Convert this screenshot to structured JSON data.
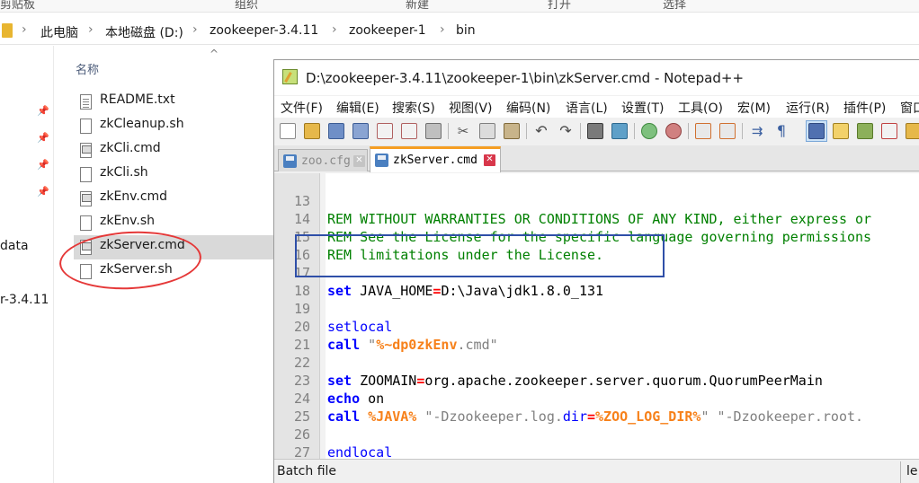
{
  "explorer": {
    "ribbon_groups": [
      "剪贴板",
      "组织",
      "新建",
      "打开",
      "选择"
    ],
    "breadcrumb": [
      "此电脑",
      "本地磁盘 (D:)",
      "zookeeper-3.4.11",
      "zookeeper-1",
      "bin"
    ],
    "nav_partial_labels": [
      "data",
      "r-3.4.11"
    ],
    "column_header": "名称",
    "files": [
      {
        "name": "README.txt",
        "icon": "text-file-icon"
      },
      {
        "name": "zkCleanup.sh",
        "icon": "blank-file-icon"
      },
      {
        "name": "zkCli.cmd",
        "icon": "cmd-file-icon"
      },
      {
        "name": "zkCli.sh",
        "icon": "blank-file-icon"
      },
      {
        "name": "zkEnv.cmd",
        "icon": "cmd-file-icon"
      },
      {
        "name": "zkEnv.sh",
        "icon": "blank-file-icon"
      },
      {
        "name": "zkServer.cmd",
        "icon": "cmd-file-icon",
        "selected": true
      },
      {
        "name": "zkServer.sh",
        "icon": "blank-file-icon"
      }
    ],
    "annotation_color": "#e53838"
  },
  "npp": {
    "title": "D:\\zookeeper-3.4.11\\zookeeper-1\\bin\\zkServer.cmd - Notepad++",
    "menu": [
      "文件(F)",
      "编辑(E)",
      "搜索(S)",
      "视图(V)",
      "编码(N)",
      "语言(L)",
      "设置(T)",
      "工具(O)",
      "宏(M)",
      "运行(R)",
      "插件(P)",
      "窗口"
    ],
    "tabs": [
      {
        "label": "zoo.cfg",
        "active": false
      },
      {
        "label": "zkServer.cmd",
        "active": true
      }
    ],
    "code_lines": [
      {
        "n": "13"
      },
      {
        "n": "14"
      },
      {
        "n": "15"
      },
      {
        "n": "16"
      },
      {
        "n": "17"
      },
      {
        "n": "18"
      },
      {
        "n": "19"
      },
      {
        "n": "20"
      },
      {
        "n": "21"
      },
      {
        "n": "22"
      },
      {
        "n": "23"
      },
      {
        "n": "24"
      },
      {
        "n": "25"
      },
      {
        "n": "26"
      },
      {
        "n": "27"
      }
    ],
    "code": {
      "l13": "REM WITHOUT WARRANTIES OR CONDITIONS OF ANY KIND, either express or",
      "l14": "REM See the License for the specific language governing permissions",
      "l15": "REM limitations under the License.",
      "l17_kw": "set",
      "l17_name": " JAVA_HOME",
      "l17_eq": "=",
      "l17_val": "D:\\Java\\jdk1.8.0_131",
      "l19": "setlocal",
      "l20_kw": "call",
      "l20_q1": " \"",
      "l20_var": "%~dp0zkEnv",
      "l20_rest": ".cmd\"",
      "l22_kw": "set",
      "l22_name": " ZOOMAIN",
      "l22_eq": "=",
      "l22_val": "org.apache.zookeeper.server.quorum.QuorumPeerMain",
      "l23_kw": "echo",
      "l23_val": " on",
      "l24_kw": "call",
      "l24_var": " %JAVA%",
      "l24_s1": " \"-Dzookeeper.log.",
      "l24_dir": "dir",
      "l24_eq": "=",
      "l24_var2": "%ZOO_LOG_DIR%",
      "l24_s2": "\" \"-Dzookeeper.root.",
      "l26": "endlocal"
    },
    "status_lang": "Batch file",
    "status_len": "le",
    "highlight_color": "#2f4fa8"
  }
}
